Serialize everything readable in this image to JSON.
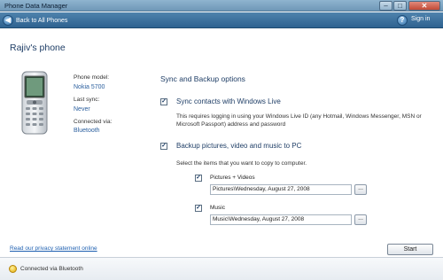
{
  "window": {
    "title": "Phone Data Manager",
    "controls": {
      "minimize": "–",
      "maximize": "□",
      "close": "✕"
    }
  },
  "nav": {
    "back_label": "Back to All Phones",
    "help_glyph": "?",
    "signin_label": "Sign in"
  },
  "phone": {
    "name": "Rajiv's phone",
    "model_label": "Phone model:",
    "model_value": "Nokia 5700",
    "last_sync_label": "Last sync:",
    "last_sync_value": "Never",
    "connected_label": "Connected via:",
    "connected_value": "Bluetooth"
  },
  "sync": {
    "section_title": "Sync and Backup options",
    "contacts": {
      "checked": true,
      "label": "Sync contacts with Windows Live",
      "description": "This requires logging in using your Windows Live ID (any Hotmail, Windows Messenger, MSN or Microsoft Passport) address and password"
    },
    "backup": {
      "checked": true,
      "label": "Backup pictures, video and music to PC",
      "instructions": "Select the items that you want to copy to computer.",
      "pictures": {
        "checked": true,
        "label": "Pictures + Videos",
        "path": "Pictures\\Wednesday, August 27, 2008",
        "browse_label": "..."
      },
      "music": {
        "checked": true,
        "label": "Music",
        "path": "Music\\Wednesday, August 27, 2008",
        "browse_label": "..."
      }
    }
  },
  "footer": {
    "privacy_link": "Read our privacy statement online",
    "start_label": "Start"
  },
  "status": {
    "text": "Connected via Bluetooth"
  },
  "icons": {
    "checkmark": "✓",
    "back": "◀",
    "status": "bluetooth-status-icon"
  }
}
